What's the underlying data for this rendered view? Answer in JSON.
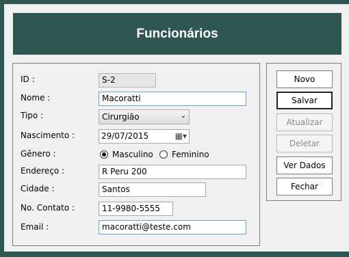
{
  "header": {
    "title": "Funcionários"
  },
  "form": {
    "id_label": "ID :",
    "id_value": "S-2",
    "nome_label": "Nome :",
    "nome_value": "Macoratti",
    "tipo_label": "Tipo :",
    "tipo_value": "Cirurgião",
    "nascimento_label": "Nascimento :",
    "nascimento_value": "29/07/2015",
    "genero_label": "Gênero :",
    "genero_options": [
      "Masculino",
      "Feminino"
    ],
    "genero_selected": "Masculino",
    "endereco_label": "Endereço :",
    "endereco_value": "R Peru 200",
    "cidade_label": "Cidade :",
    "cidade_value": "Santos",
    "contato_label": "No. Contato :",
    "contato_value": "11-9980-5555",
    "email_label": "Email :",
    "email_value": "macoratti@teste.com"
  },
  "buttons": {
    "novo": "Novo",
    "salvar": "Salvar",
    "atualizar": "Atualizar",
    "deletar": "Deletar",
    "ver_dados": "Ver Dados",
    "fechar": "Fechar"
  },
  "colors": {
    "header_bg": "#2f5650",
    "focus_border": "#5ca8c8"
  }
}
